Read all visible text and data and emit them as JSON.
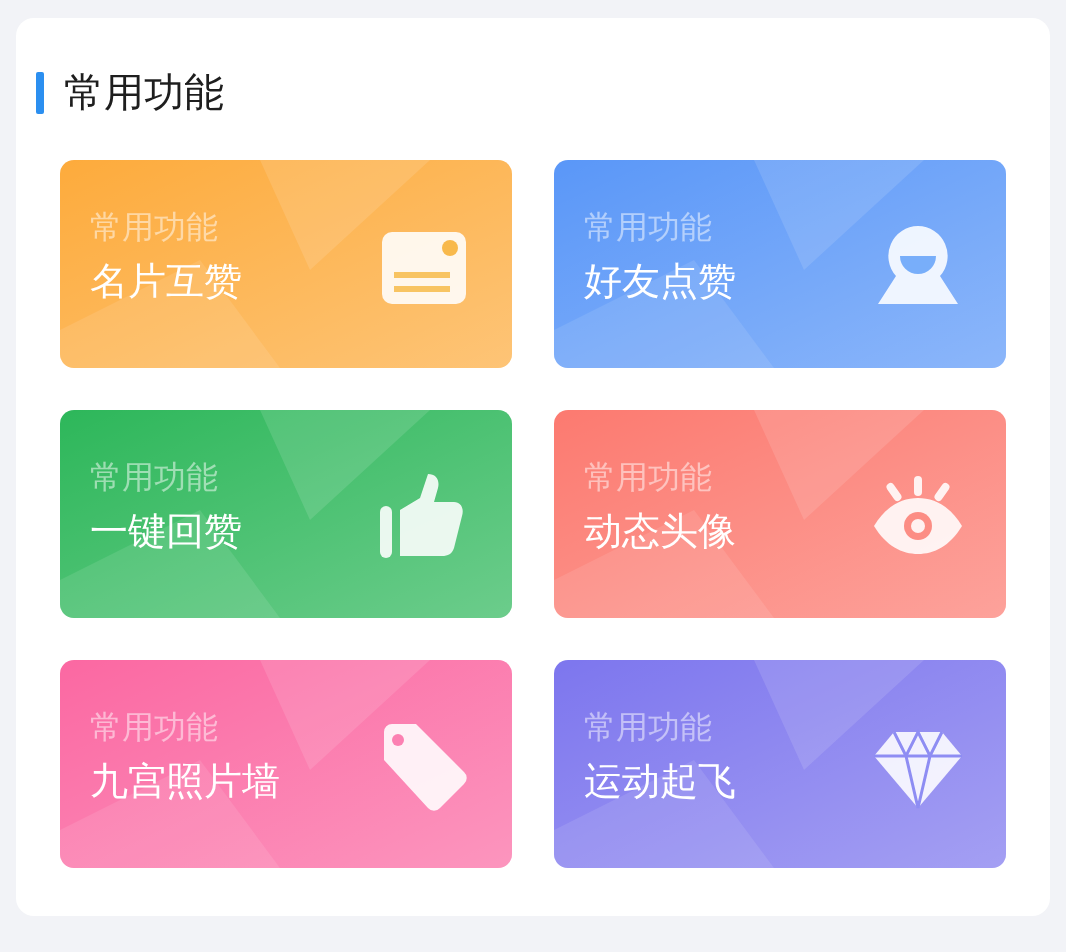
{
  "section": {
    "title": "常用功能"
  },
  "tiles": [
    {
      "caption": "常用功能",
      "title": "名片互赞",
      "kind": "card",
      "color": "#fdab3c"
    },
    {
      "caption": "常用功能",
      "title": "好友点赞",
      "kind": "person",
      "color": "#5a97f8"
    },
    {
      "caption": "常用功能",
      "title": "一键回赞",
      "kind": "thumb",
      "color": "#2db75a"
    },
    {
      "caption": "常用功能",
      "title": "动态头像",
      "kind": "eye",
      "color": "#fc7a70"
    },
    {
      "caption": "常用功能",
      "title": "九宫照片墙",
      "kind": "tag",
      "color": "#fb68a2"
    },
    {
      "caption": "常用功能",
      "title": "运动起飞",
      "kind": "diamond",
      "color": "#7d76ee"
    }
  ]
}
